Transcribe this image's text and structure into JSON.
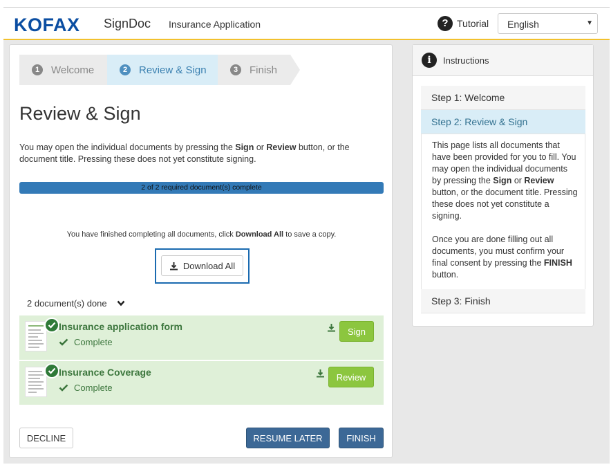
{
  "header": {
    "logo": "KOFAX",
    "product": "SignDoc",
    "app_name": "Insurance Application",
    "tutorial_label": "Tutorial",
    "language": "English"
  },
  "steps": [
    {
      "num": "1",
      "label": "Welcome"
    },
    {
      "num": "2",
      "label": "Review & Sign"
    },
    {
      "num": "3",
      "label": "Finish"
    }
  ],
  "main": {
    "title": "Review & Sign",
    "intro": {
      "t1": "You may open the individual documents by pressing the ",
      "sign": "Sign",
      "t2": " or ",
      "review": "Review",
      "t3": " button, or the document title. Pressing these does not yet constitute signing."
    },
    "progress_text": "2 of 2 required document(s) complete",
    "progress_fraction": 1.0,
    "finished": {
      "t1": "You have finished completing all documents, click ",
      "bold": "Download All",
      "t2": " to save a copy."
    },
    "download_all_label": "Download All",
    "done_toggle": "2 document(s) done",
    "documents": [
      {
        "name": "Insurance application form",
        "status": "Complete",
        "action": "Sign"
      },
      {
        "name": "Insurance Coverage",
        "status": "Complete",
        "action": "Review"
      }
    ],
    "decline_label": "DECLINE",
    "resume_label": "RESUME LATER",
    "finish_label": "FINISH"
  },
  "instructions": {
    "title": "Instructions",
    "step1": "Step 1: Welcome",
    "step2": "Step 2: Review & Sign",
    "body1": {
      "t1": "This page lists all documents that have been provided for you to fill. You may open the individual documents by pressing the ",
      "sign": "Sign",
      "t2": " or ",
      "review": "Review",
      "t3": " button, or the document title. Pressing these does not yet constitute a signing."
    },
    "body2": {
      "t1": "Once you are done filling out all documents, you must confirm your final consent by pressing the ",
      "finish": "FINISH",
      "t2": " button."
    },
    "step3": "Step 3: Finish"
  },
  "colors": {
    "brand": "#0b4ea2",
    "accent_bar": "#f2c12e",
    "progress": "#337ab7",
    "success_bg": "#dff0d8",
    "success_text": "#3c763d",
    "action_green": "#8cc63f",
    "primary_button": "#3c6896",
    "active_step_bg": "#d9edf7"
  }
}
